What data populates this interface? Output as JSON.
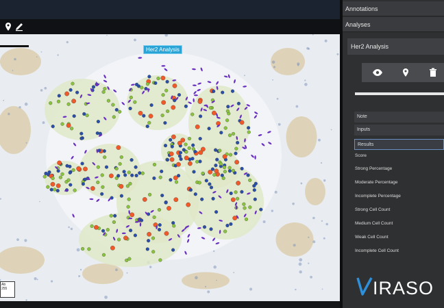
{
  "toolbar": {
    "icons": [
      "map-pin-icon",
      "pencil-icon"
    ]
  },
  "viewer": {
    "annotation_label": "Her2 Analysis",
    "corner_box_lines": [
      "Ab",
      "255"
    ]
  },
  "panel": {
    "sections": {
      "annotations": "Annotations",
      "analyses": "Analyses"
    },
    "analysis_title": "Her2 Analysis",
    "actions": [
      "eye-icon",
      "map-pin-icon",
      "trash-icon"
    ],
    "progress": 1.0,
    "fields": {
      "note": "Note",
      "inputs": "Inputs",
      "results": "Results"
    },
    "result_labels": [
      "Score",
      "Strong Percentage",
      "Moderate Percentage",
      "Incomplete Percentage",
      "Strong Cell Count",
      "Medium Cell Count",
      "Weak Cell Count",
      "Incomplete Cell Count"
    ]
  },
  "logo": {
    "text": "IRASO",
    "accent": "#2f8fd8"
  },
  "colors": {
    "cell_strong": "#f05a2a",
    "cell_moderate": "#8ac43f",
    "cell_negative": "#2a4fa8",
    "cell_stromal": "#6a2fc0"
  }
}
